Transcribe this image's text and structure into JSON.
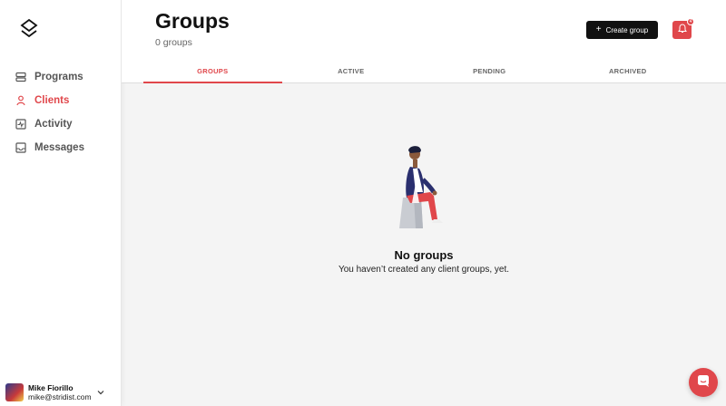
{
  "sidebar": {
    "items": [
      {
        "label": "Programs",
        "icon": "programs-icon"
      },
      {
        "label": "Clients",
        "icon": "clients-icon",
        "active": true
      },
      {
        "label": "Activity",
        "icon": "activity-icon"
      },
      {
        "label": "Messages",
        "icon": "messages-icon"
      }
    ],
    "user": {
      "name": "Mike Fiorillo",
      "email": "mike@stridist.com"
    }
  },
  "header": {
    "title": "Groups",
    "subtitle": "0 groups",
    "create_label": "Create group",
    "notification_count": "4"
  },
  "tabs": [
    {
      "label": "GROUPS",
      "active": true
    },
    {
      "label": "ACTIVE"
    },
    {
      "label": "PENDING"
    },
    {
      "label": "ARCHIVED"
    }
  ],
  "empty_state": {
    "title": "No groups",
    "text": "You haven’t created any client groups, yet."
  },
  "colors": {
    "accent": "#e0474b",
    "dark": "#111111",
    "background": "#f4f4f4"
  }
}
